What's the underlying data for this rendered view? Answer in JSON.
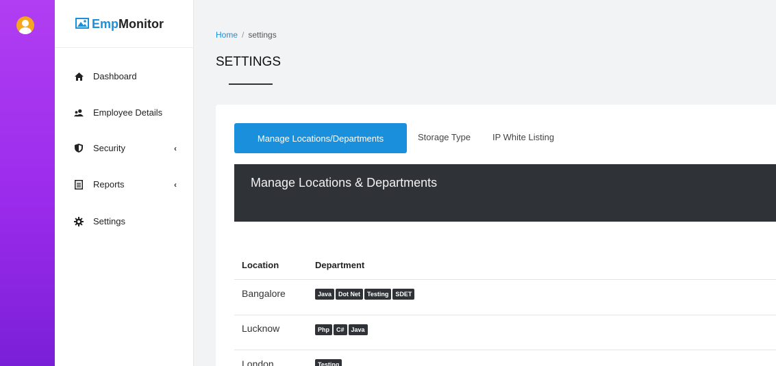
{
  "brand": {
    "prefix": "Emp",
    "suffix": "Monitor"
  },
  "sidebar": {
    "items": [
      {
        "label": "Dashboard",
        "icon": "home-icon",
        "has_submenu": false
      },
      {
        "label": "Employee Details",
        "icon": "users-icon",
        "has_submenu": false
      },
      {
        "label": "Security",
        "icon": "shield-icon",
        "has_submenu": true
      },
      {
        "label": "Reports",
        "icon": "document-icon",
        "has_submenu": true
      },
      {
        "label": "Settings",
        "icon": "gear-icon",
        "has_submenu": false
      }
    ],
    "chevron": "‹"
  },
  "breadcrumb": {
    "home": "Home",
    "separator": "/",
    "current": "settings"
  },
  "page_title": "SETTINGS",
  "tabs": [
    {
      "label": "Manage Locations/Departments",
      "active": true
    },
    {
      "label": "Storage Type",
      "active": false
    },
    {
      "label": "IP White Listing",
      "active": false
    }
  ],
  "panel": {
    "title": "Manage Locations & Departments"
  },
  "table": {
    "headers": [
      "Location",
      "Department"
    ],
    "rows": [
      {
        "location": "Bangalore",
        "departments": [
          "Java",
          "Dot Net",
          "Testing",
          "SDET"
        ]
      },
      {
        "location": "Lucknow",
        "departments": [
          "Php",
          "C#",
          "Java"
        ]
      },
      {
        "location": "London",
        "departments": [
          "Testing"
        ]
      }
    ]
  },
  "colors": {
    "accent": "#1a8fdc",
    "rail_top": "#b13ef2",
    "rail_bottom": "#7a1fd8",
    "panel_dark": "#2f3236"
  }
}
